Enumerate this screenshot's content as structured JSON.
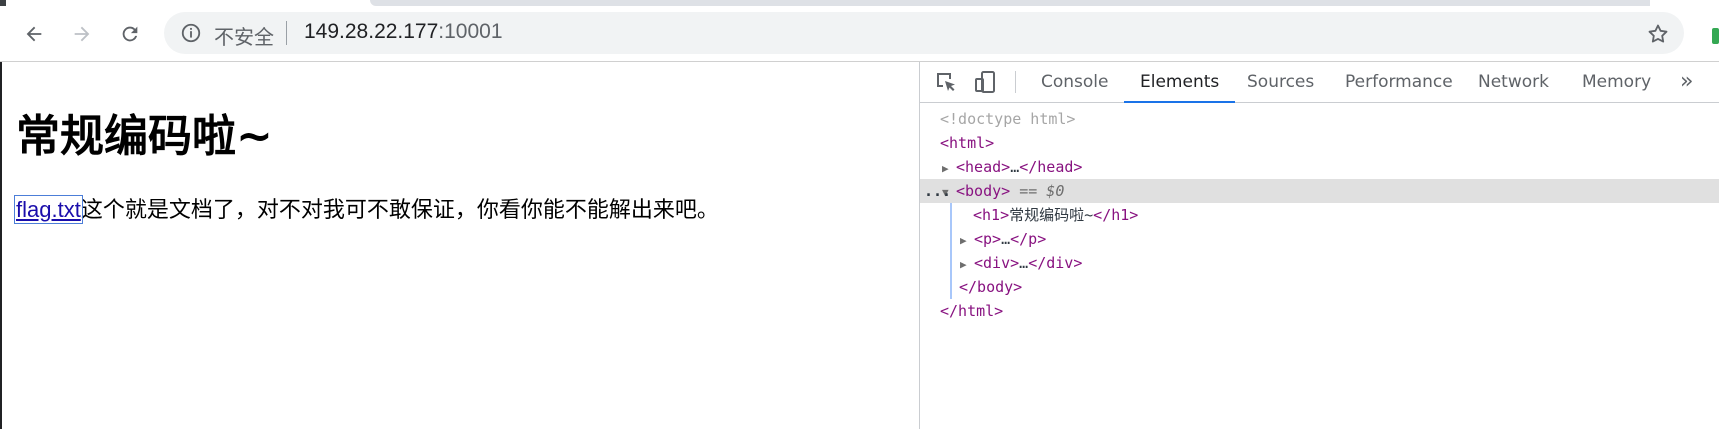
{
  "browser": {
    "security_label": "不安全",
    "url_host": "149.28.22.177",
    "url_port": ":10001"
  },
  "page": {
    "heading": "常规编码啦~",
    "link_text": "flag.txt",
    "paragraph_text": "这个就是文档了，对不对我可不敢保证，你看你能不能解出来吧。"
  },
  "devtools": {
    "tabs": [
      {
        "label": "Console"
      },
      {
        "label": "Elements",
        "active": true
      },
      {
        "label": "Sources"
      },
      {
        "label": "Performance"
      },
      {
        "label": "Network"
      },
      {
        "label": "Memory"
      }
    ],
    "more_label": "»",
    "tree": {
      "doctype": "<!doctype html>",
      "html_open": "<html>",
      "head_open": "<head>",
      "head_ellipsis": "…",
      "head_close": "</head>",
      "row_dots": "...",
      "body_open": "<body>",
      "body_marker": " == $0",
      "h1_open": "<h1>",
      "h1_text": "常规编码啦~",
      "h1_close": "</h1>",
      "p_open": "<p>",
      "p_ellipsis": "…",
      "p_close": "</p>",
      "div_open": "<div>",
      "div_ellipsis": "…",
      "div_close": "</div>",
      "body_close": "</body>",
      "html_close": "</html>"
    }
  },
  "colors": {
    "tag": "#881280",
    "active_tab_underline": "#1a73e8",
    "link": "#1a0dab"
  }
}
